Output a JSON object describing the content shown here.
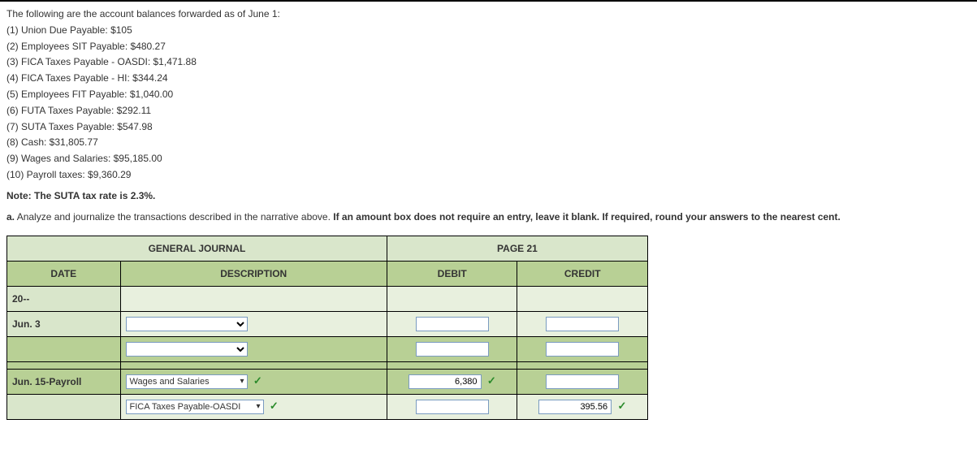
{
  "intro_line": "The following are the account balances forwarded as of June 1:",
  "balances": [
    "(1) Union Due Payable: $105",
    "(2) Employees SIT Payable: $480.27",
    "(3) FICA Taxes Payable - OASDI: $1,471.88",
    "(4) FICA Taxes Payable - HI: $344.24",
    "(5) Employees FIT Payable: $1,040.00",
    "(6) FUTA Taxes Payable: $292.11",
    "(7) SUTA Taxes Payable: $547.98",
    "(8) Cash: $31,805.77",
    "(9) Wages and Salaries: $95,185.00",
    "(10) Payroll taxes: $9,360.29"
  ],
  "note": "Note: The SUTA tax rate is 2.3%.",
  "instr_prefix": "a.",
  "instr_plain": "  Analyze and journalize the transactions described in the narrative above. ",
  "instr_bold": "If an amount box does not require an entry, leave it blank. If required, round your answers to the nearest cent.",
  "journal": {
    "title": "GENERAL JOURNAL",
    "page": "PAGE 21",
    "cols": {
      "date": "DATE",
      "desc": "DESCRIPTION",
      "debit": "DEBIT",
      "credit": "CREDIT"
    },
    "year": "20--",
    "rows": {
      "r1_date": "Jun. 3",
      "r3_date": "Jun. 15-Payroll",
      "r3_desc": "Wages and Salaries",
      "r3_debit": "6,380",
      "r4_desc": "FICA Taxes Payable-OASDI",
      "r4_credit": "395.56"
    }
  }
}
